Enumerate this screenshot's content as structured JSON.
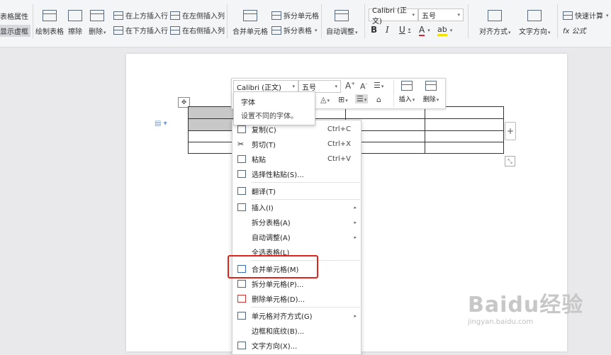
{
  "ribbon": {
    "table_props": "表格属性",
    "show_border": "显示虚框",
    "draw_table": "绘制表格",
    "erase": "擦除",
    "delete": "删除",
    "insert_above": "在上方插入行",
    "insert_below": "在下方插入行",
    "insert_left": "在左侧插入列",
    "insert_right": "在右侧插入列",
    "merge_cells": "合并单元格",
    "split_cells": "拆分单元格",
    "split_table": "拆分表格",
    "autofit": "自动调整",
    "font_name": "Calibri (正文)",
    "font_size": "五号",
    "bold": "B",
    "italic": "I",
    "underline": "U",
    "font_color": "A",
    "highlight": "ab",
    "align": "对齐方式",
    "text_dir": "文字方向",
    "quick_calc": "快速计算",
    "formula": "fx 公式"
  },
  "mini_toolbar": {
    "font_name": "Calibri (正文)",
    "font_size": "五号",
    "grow": "A",
    "shrink": "A",
    "insert": "插入",
    "delete": "删除"
  },
  "tooltip": {
    "title": "字体",
    "desc": "设置不同的字体。"
  },
  "context_menu": {
    "copy": "复制(C)",
    "copy_sc": "Ctrl+C",
    "cut": "剪切(T)",
    "cut_sc": "Ctrl+X",
    "paste": "粘贴",
    "paste_sc": "Ctrl+V",
    "paste_special": "选择性粘贴(S)...",
    "translate": "翻译(T)",
    "insert": "插入(I)",
    "split_table": "拆分表格(A)",
    "autofit": "自动调整(A)",
    "select_table": "全选表格(L)",
    "merge_cells": "合并单元格(M)",
    "split_cells": "拆分单元格(P)...",
    "delete_cells": "删除单元格(D)...",
    "cell_align": "单元格对齐方式(G)",
    "borders": "边框和底纹(B)...",
    "text_dir": "文字方向(X)..."
  },
  "watermark": {
    "brand": "Baidu经验",
    "url": "jingyan.baidu.com"
  }
}
